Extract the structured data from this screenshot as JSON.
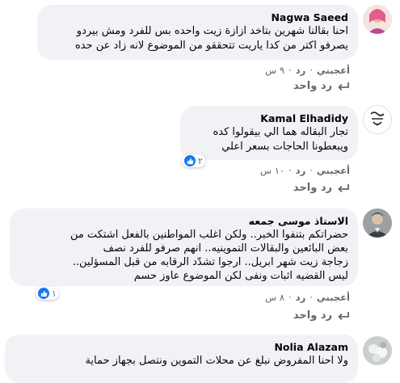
{
  "comments": [
    {
      "author": "Nagwa Saeed",
      "text": "احنا بقالنا شهرين بتاخد ازازة زيت واحده بس للفرد ومش بيردو\nيصرفو اكتر من كدا ياريت تتحققو من الموضوع لانه زاد عن حده",
      "like_label": "أعجبني",
      "reply_label": "رد",
      "time": "٩ س",
      "view_replies_label": "رد واحد",
      "reaction_count": ""
    },
    {
      "author": "Kamal Elhadidy",
      "text": "تجار البقاله هما الي بيقولوا كده\nويبعطونا الحاجات بسعر اعلي",
      "like_label": "أعجبني",
      "reply_label": "رد",
      "time": "١٠ س",
      "view_replies_label": "رد واحد",
      "reaction_count": "٢"
    },
    {
      "author": "الاستاذ موسى جمعه",
      "text": "حضراتكم بتنفوا الخبر.. ولكن اغلب المواطنين بالفعل اشتكت من\nبعض البائعين والبقالات التموينيه.. انهم صرفو للفرد نصف\nزجاجة زيت شهر ابريل.. ارجوا تشدّد الرقابه من قبل المسؤلين..\nليس القضيه اثبات ونفى لكن الموضوع عاوز حسم",
      "like_label": "أعجبني",
      "reply_label": "رد",
      "time": "٨ س",
      "view_replies_label": "رد واحد",
      "reaction_count": "١"
    },
    {
      "author": "Nolia Alazam",
      "text": "ولا احنا المفروض نبلغ عن محلات التموين ونتصل بجهاز حماية"
    }
  ],
  "icons": {
    "like": "like-icon",
    "reply": "reply-arrow-icon"
  },
  "colors": {
    "bubble": "#f0f2f5",
    "meta_text": "#65676b",
    "like_blue": "#1877f2"
  }
}
